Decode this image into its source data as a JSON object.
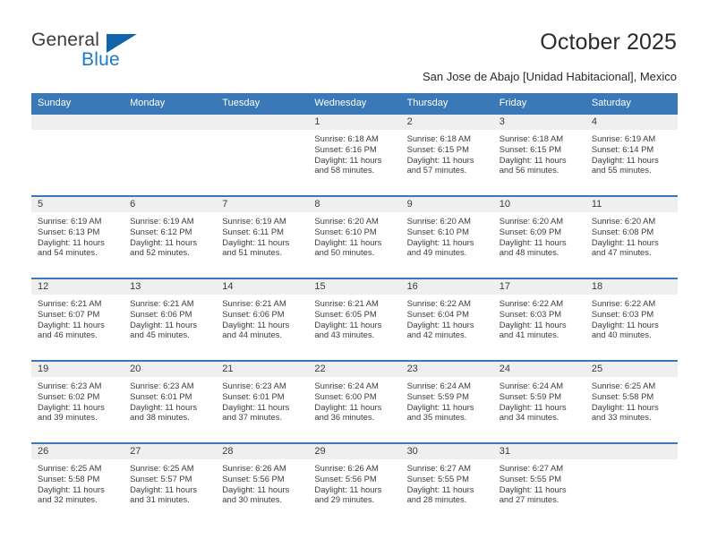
{
  "brand": {
    "name_part1": "General",
    "name_part2": "Blue",
    "triangle_icon": "blue-triangle-icon",
    "accent_color": "#1a7bc4",
    "header_color": "#3b78b7"
  },
  "header": {
    "title": "October 2025",
    "subtitle": "San Jose de Abajo [Unidad Habitacional], Mexico"
  },
  "calendar": {
    "weekday_headers": [
      "Sunday",
      "Monday",
      "Tuesday",
      "Wednesday",
      "Thursday",
      "Friday",
      "Saturday"
    ],
    "weeks": [
      [
        {
          "day": "",
          "sunrise": "",
          "sunset": "",
          "daylight_line1": "",
          "daylight_line2": ""
        },
        {
          "day": "",
          "sunrise": "",
          "sunset": "",
          "daylight_line1": "",
          "daylight_line2": ""
        },
        {
          "day": "",
          "sunrise": "",
          "sunset": "",
          "daylight_line1": "",
          "daylight_line2": ""
        },
        {
          "day": "1",
          "sunrise": "Sunrise: 6:18 AM",
          "sunset": "Sunset: 6:16 PM",
          "daylight_line1": "Daylight: 11 hours",
          "daylight_line2": "and 58 minutes."
        },
        {
          "day": "2",
          "sunrise": "Sunrise: 6:18 AM",
          "sunset": "Sunset: 6:15 PM",
          "daylight_line1": "Daylight: 11 hours",
          "daylight_line2": "and 57 minutes."
        },
        {
          "day": "3",
          "sunrise": "Sunrise: 6:18 AM",
          "sunset": "Sunset: 6:15 PM",
          "daylight_line1": "Daylight: 11 hours",
          "daylight_line2": "and 56 minutes."
        },
        {
          "day": "4",
          "sunrise": "Sunrise: 6:19 AM",
          "sunset": "Sunset: 6:14 PM",
          "daylight_line1": "Daylight: 11 hours",
          "daylight_line2": "and 55 minutes."
        }
      ],
      [
        {
          "day": "5",
          "sunrise": "Sunrise: 6:19 AM",
          "sunset": "Sunset: 6:13 PM",
          "daylight_line1": "Daylight: 11 hours",
          "daylight_line2": "and 54 minutes."
        },
        {
          "day": "6",
          "sunrise": "Sunrise: 6:19 AM",
          "sunset": "Sunset: 6:12 PM",
          "daylight_line1": "Daylight: 11 hours",
          "daylight_line2": "and 52 minutes."
        },
        {
          "day": "7",
          "sunrise": "Sunrise: 6:19 AM",
          "sunset": "Sunset: 6:11 PM",
          "daylight_line1": "Daylight: 11 hours",
          "daylight_line2": "and 51 minutes."
        },
        {
          "day": "8",
          "sunrise": "Sunrise: 6:20 AM",
          "sunset": "Sunset: 6:10 PM",
          "daylight_line1": "Daylight: 11 hours",
          "daylight_line2": "and 50 minutes."
        },
        {
          "day": "9",
          "sunrise": "Sunrise: 6:20 AM",
          "sunset": "Sunset: 6:10 PM",
          "daylight_line1": "Daylight: 11 hours",
          "daylight_line2": "and 49 minutes."
        },
        {
          "day": "10",
          "sunrise": "Sunrise: 6:20 AM",
          "sunset": "Sunset: 6:09 PM",
          "daylight_line1": "Daylight: 11 hours",
          "daylight_line2": "and 48 minutes."
        },
        {
          "day": "11",
          "sunrise": "Sunrise: 6:20 AM",
          "sunset": "Sunset: 6:08 PM",
          "daylight_line1": "Daylight: 11 hours",
          "daylight_line2": "and 47 minutes."
        }
      ],
      [
        {
          "day": "12",
          "sunrise": "Sunrise: 6:21 AM",
          "sunset": "Sunset: 6:07 PM",
          "daylight_line1": "Daylight: 11 hours",
          "daylight_line2": "and 46 minutes."
        },
        {
          "day": "13",
          "sunrise": "Sunrise: 6:21 AM",
          "sunset": "Sunset: 6:06 PM",
          "daylight_line1": "Daylight: 11 hours",
          "daylight_line2": "and 45 minutes."
        },
        {
          "day": "14",
          "sunrise": "Sunrise: 6:21 AM",
          "sunset": "Sunset: 6:06 PM",
          "daylight_line1": "Daylight: 11 hours",
          "daylight_line2": "and 44 minutes."
        },
        {
          "day": "15",
          "sunrise": "Sunrise: 6:21 AM",
          "sunset": "Sunset: 6:05 PM",
          "daylight_line1": "Daylight: 11 hours",
          "daylight_line2": "and 43 minutes."
        },
        {
          "day": "16",
          "sunrise": "Sunrise: 6:22 AM",
          "sunset": "Sunset: 6:04 PM",
          "daylight_line1": "Daylight: 11 hours",
          "daylight_line2": "and 42 minutes."
        },
        {
          "day": "17",
          "sunrise": "Sunrise: 6:22 AM",
          "sunset": "Sunset: 6:03 PM",
          "daylight_line1": "Daylight: 11 hours",
          "daylight_line2": "and 41 minutes."
        },
        {
          "day": "18",
          "sunrise": "Sunrise: 6:22 AM",
          "sunset": "Sunset: 6:03 PM",
          "daylight_line1": "Daylight: 11 hours",
          "daylight_line2": "and 40 minutes."
        }
      ],
      [
        {
          "day": "19",
          "sunrise": "Sunrise: 6:23 AM",
          "sunset": "Sunset: 6:02 PM",
          "daylight_line1": "Daylight: 11 hours",
          "daylight_line2": "and 39 minutes."
        },
        {
          "day": "20",
          "sunrise": "Sunrise: 6:23 AM",
          "sunset": "Sunset: 6:01 PM",
          "daylight_line1": "Daylight: 11 hours",
          "daylight_line2": "and 38 minutes."
        },
        {
          "day": "21",
          "sunrise": "Sunrise: 6:23 AM",
          "sunset": "Sunset: 6:01 PM",
          "daylight_line1": "Daylight: 11 hours",
          "daylight_line2": "and 37 minutes."
        },
        {
          "day": "22",
          "sunrise": "Sunrise: 6:24 AM",
          "sunset": "Sunset: 6:00 PM",
          "daylight_line1": "Daylight: 11 hours",
          "daylight_line2": "and 36 minutes."
        },
        {
          "day": "23",
          "sunrise": "Sunrise: 6:24 AM",
          "sunset": "Sunset: 5:59 PM",
          "daylight_line1": "Daylight: 11 hours",
          "daylight_line2": "and 35 minutes."
        },
        {
          "day": "24",
          "sunrise": "Sunrise: 6:24 AM",
          "sunset": "Sunset: 5:59 PM",
          "daylight_line1": "Daylight: 11 hours",
          "daylight_line2": "and 34 minutes."
        },
        {
          "day": "25",
          "sunrise": "Sunrise: 6:25 AM",
          "sunset": "Sunset: 5:58 PM",
          "daylight_line1": "Daylight: 11 hours",
          "daylight_line2": "and 33 minutes."
        }
      ],
      [
        {
          "day": "26",
          "sunrise": "Sunrise: 6:25 AM",
          "sunset": "Sunset: 5:58 PM",
          "daylight_line1": "Daylight: 11 hours",
          "daylight_line2": "and 32 minutes."
        },
        {
          "day": "27",
          "sunrise": "Sunrise: 6:25 AM",
          "sunset": "Sunset: 5:57 PM",
          "daylight_line1": "Daylight: 11 hours",
          "daylight_line2": "and 31 minutes."
        },
        {
          "day": "28",
          "sunrise": "Sunrise: 6:26 AM",
          "sunset": "Sunset: 5:56 PM",
          "daylight_line1": "Daylight: 11 hours",
          "daylight_line2": "and 30 minutes."
        },
        {
          "day": "29",
          "sunrise": "Sunrise: 6:26 AM",
          "sunset": "Sunset: 5:56 PM",
          "daylight_line1": "Daylight: 11 hours",
          "daylight_line2": "and 29 minutes."
        },
        {
          "day": "30",
          "sunrise": "Sunrise: 6:27 AM",
          "sunset": "Sunset: 5:55 PM",
          "daylight_line1": "Daylight: 11 hours",
          "daylight_line2": "and 28 minutes."
        },
        {
          "day": "31",
          "sunrise": "Sunrise: 6:27 AM",
          "sunset": "Sunset: 5:55 PM",
          "daylight_line1": "Daylight: 11 hours",
          "daylight_line2": "and 27 minutes."
        },
        {
          "day": "",
          "sunrise": "",
          "sunset": "",
          "daylight_line1": "",
          "daylight_line2": ""
        }
      ]
    ]
  }
}
